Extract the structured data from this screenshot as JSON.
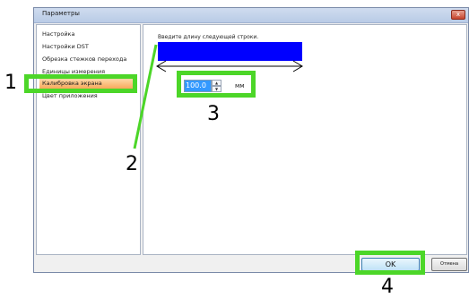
{
  "window": {
    "title": "Параметры",
    "close_label": "x"
  },
  "sidebar": {
    "items": [
      {
        "label": "Настройка"
      },
      {
        "label": "Настройки DST"
      },
      {
        "label": "Обрезка стежков перехода"
      },
      {
        "label": "Единицы измерения"
      },
      {
        "label": "Калибровка экрана",
        "selected": true
      },
      {
        "label": "Цвет приложения"
      }
    ]
  },
  "main": {
    "instruction": "Введите длину следующей строки.",
    "bar_color": "#0000ff",
    "length_value": "100.0",
    "unit": "мм"
  },
  "footer": {
    "ok_label": "OK",
    "cancel_label": "Отмена"
  },
  "callouts": {
    "color": "#4cd628",
    "labels": [
      "1",
      "2",
      "3",
      "4"
    ]
  }
}
